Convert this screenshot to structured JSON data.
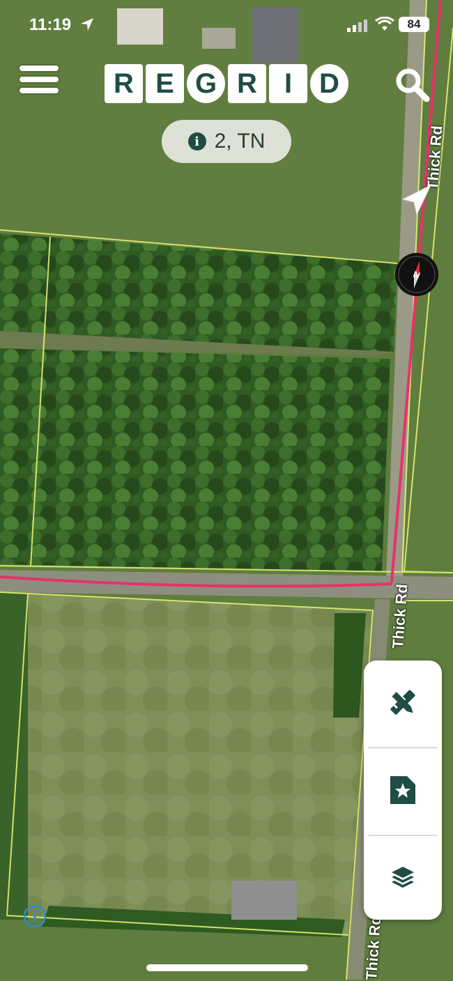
{
  "status_bar": {
    "time": "11:19",
    "battery": "84"
  },
  "header": {
    "logo_letters": [
      "R",
      "E",
      "G",
      "R",
      "I",
      "D"
    ]
  },
  "region_pill": {
    "info_glyph": "i",
    "label": "2, TN"
  },
  "roads": {
    "vertical_name": "Thick Rd"
  },
  "icons": {
    "menu": "hamburger-menu-icon",
    "search": "magnifier-icon",
    "nav": "location-arrow-icon",
    "compass": "compass-icon",
    "draw": "ruler-pencil-icon",
    "saved": "bookmark-star-icon",
    "layers": "layers-icon",
    "info": "info-icon"
  },
  "colors": {
    "brand": "#1f4d44",
    "road": "#e8316b",
    "parcel": "#e4f070",
    "info_blue": "#2a8bd8"
  }
}
